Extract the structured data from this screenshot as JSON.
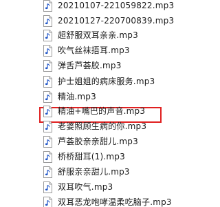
{
  "files": [
    {
      "name": "20210107-221059822.mp3"
    },
    {
      "name": "20210127-220700839.mp3"
    },
    {
      "name": "超舒服双耳亲亲.mp3"
    },
    {
      "name": "吹气丝袜捂耳.mp3"
    },
    {
      "name": "弹舌芦荟胶.mp3"
    },
    {
      "name": "护士姐姐的病床服务.mp3"
    },
    {
      "name": "精油.mp3"
    },
    {
      "name": "精油+嘴巴的声音.mp3"
    },
    {
      "name": "老婆照顾生病的你.mp3"
    },
    {
      "name": "芦荟胶亲亲甜儿.mp3"
    },
    {
      "name": "桥桥甜耳(1).mp3"
    },
    {
      "name": "舒服亲亲甜儿.mp3"
    },
    {
      "name": "双耳吹气.mp3"
    },
    {
      "name": "双耳恶龙咆哮温柔吃脑子.mp3"
    }
  ],
  "highlight": {
    "color": "#e02020",
    "selected_index": 5
  },
  "icon": {
    "name": "audio-file-icon",
    "note_color": "#1f55c8"
  }
}
